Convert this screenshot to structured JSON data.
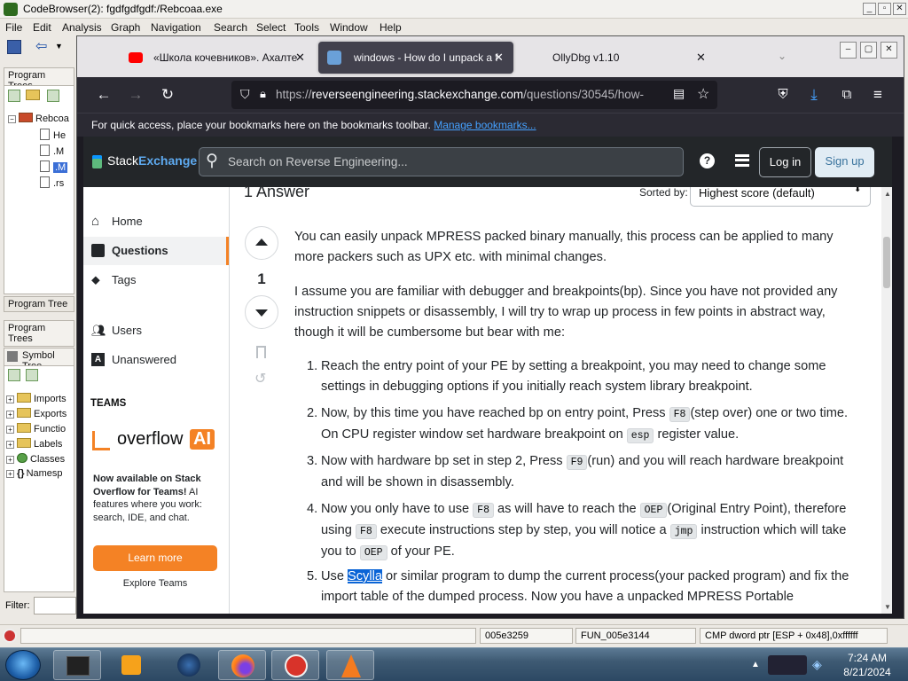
{
  "ghidra": {
    "title": "CodeBrowser(2): fgdfgdfgdf:/Rebcoaa.exe",
    "menu": [
      "File",
      "Edit",
      "Analysis",
      "Graph",
      "Navigation",
      "Search",
      "Select",
      "Tools",
      "Window",
      "Help"
    ],
    "program_trees_tab": "Program Trees",
    "tree_root": "Rebcoa",
    "tree_items": [
      "He",
      ".M",
      ".M",
      ".rs"
    ],
    "program_tree_tab": "Program Tree",
    "program_trees_tab2": "Program Trees",
    "symbol_tree_tab": "Symbol Tree",
    "symbol_items": [
      "Imports",
      "Exports",
      "Functio",
      "Labels",
      "Classes",
      "Namesp"
    ],
    "filter_label": "Filter:",
    "status": {
      "address": "005e3259",
      "function": "FUN_005e3144",
      "instruction": "CMP dword ptr [ESP + 0x48],0xffffff"
    }
  },
  "firefox": {
    "tabs": [
      {
        "label": "«Школа кочевников». Ахалте",
        "icon": "youtube-icon"
      },
      {
        "label": "windows - How do I unpack a f",
        "icon": "stackexchange-icon"
      },
      {
        "label": "OllyDbg v1.10",
        "icon": "none"
      }
    ],
    "url_prefix": "https://",
    "url_domain": "reverseengineering.stackexchange.com",
    "url_rest": "/questions/30545/how-",
    "bookmarks_text": "For quick access, place your bookmarks here on the bookmarks toolbar.",
    "bookmarks_link": "Manage bookmarks..."
  },
  "se": {
    "logo_a": "Stack",
    "logo_b": "Exchange",
    "search_placeholder": "Search on Reverse Engineering...",
    "login": "Log in",
    "signup": "Sign up",
    "nav": {
      "home": "Home",
      "questions": "Questions",
      "tags": "Tags",
      "users": "Users",
      "unanswered": "Unanswered",
      "teams": "TEAMS",
      "overflow_a": "overflow",
      "overflow_b": "AI",
      "promo_bold": "Now available on Stack Overflow for Teams!",
      "promo_rest": " AI features where you work: search, IDE, and chat.",
      "learn_more": "Learn more",
      "explore": "Explore Teams"
    },
    "answer_count": "1 Answer",
    "sorted_by": "Sorted by:",
    "sort_value": "Highest score (default)",
    "vote_count": "1",
    "p1": "You can easily unpack MPRESS packed binary manually, this process can be applied to many more packers such as UPX etc. with minimal changes.",
    "p2": "I assume you are familiar with debugger and breakpoints(bp). Since you have not provided any instruction snippets or disassembly, I will try to wrap up process in few points in abstract way, though it will be cumbersome but bear with me:",
    "step1": "Reach the entry point of your PE by setting a breakpoint, you may need to change some settings in debugging options if you initially reach system library breakpoint.",
    "step2_a": "Now, by this time you have reached bp on entry point, Press ",
    "step2_code1": "F8",
    "step2_b": "(step over) one or two time. On CPU register window set hardware breakpoint on ",
    "step2_code2": "esp",
    "step2_c": " register value.",
    "step3_a": "Now with hardware bp set in step 2, Press ",
    "step3_code": "F9",
    "step3_b": "(run) and you will reach hardware breakpoint and will be shown in disassembly.",
    "step4_a": "Now you only have to use ",
    "step4_code1": "F8",
    "step4_b": " as will have to reach the ",
    "step4_code2": "OEP",
    "step4_c": "(Original Entry Point), therefore using ",
    "step4_code3": "F8",
    "step4_d": " execute instructions step by step, you will notice a ",
    "step4_code4": "jmp",
    "step4_e": " instruction which will take you to ",
    "step4_code5": "OEP",
    "step4_f": " of your PE.",
    "step5_a": "Use ",
    "step5_link": "Scylla",
    "step5_b": " or similar program to dump the current process(your packed program) and fix the import table of the dumped process. Now you have a unpacked MPRESS Portable"
  },
  "taskbar": {
    "time": "7:24 AM",
    "date": "8/21/2024"
  }
}
